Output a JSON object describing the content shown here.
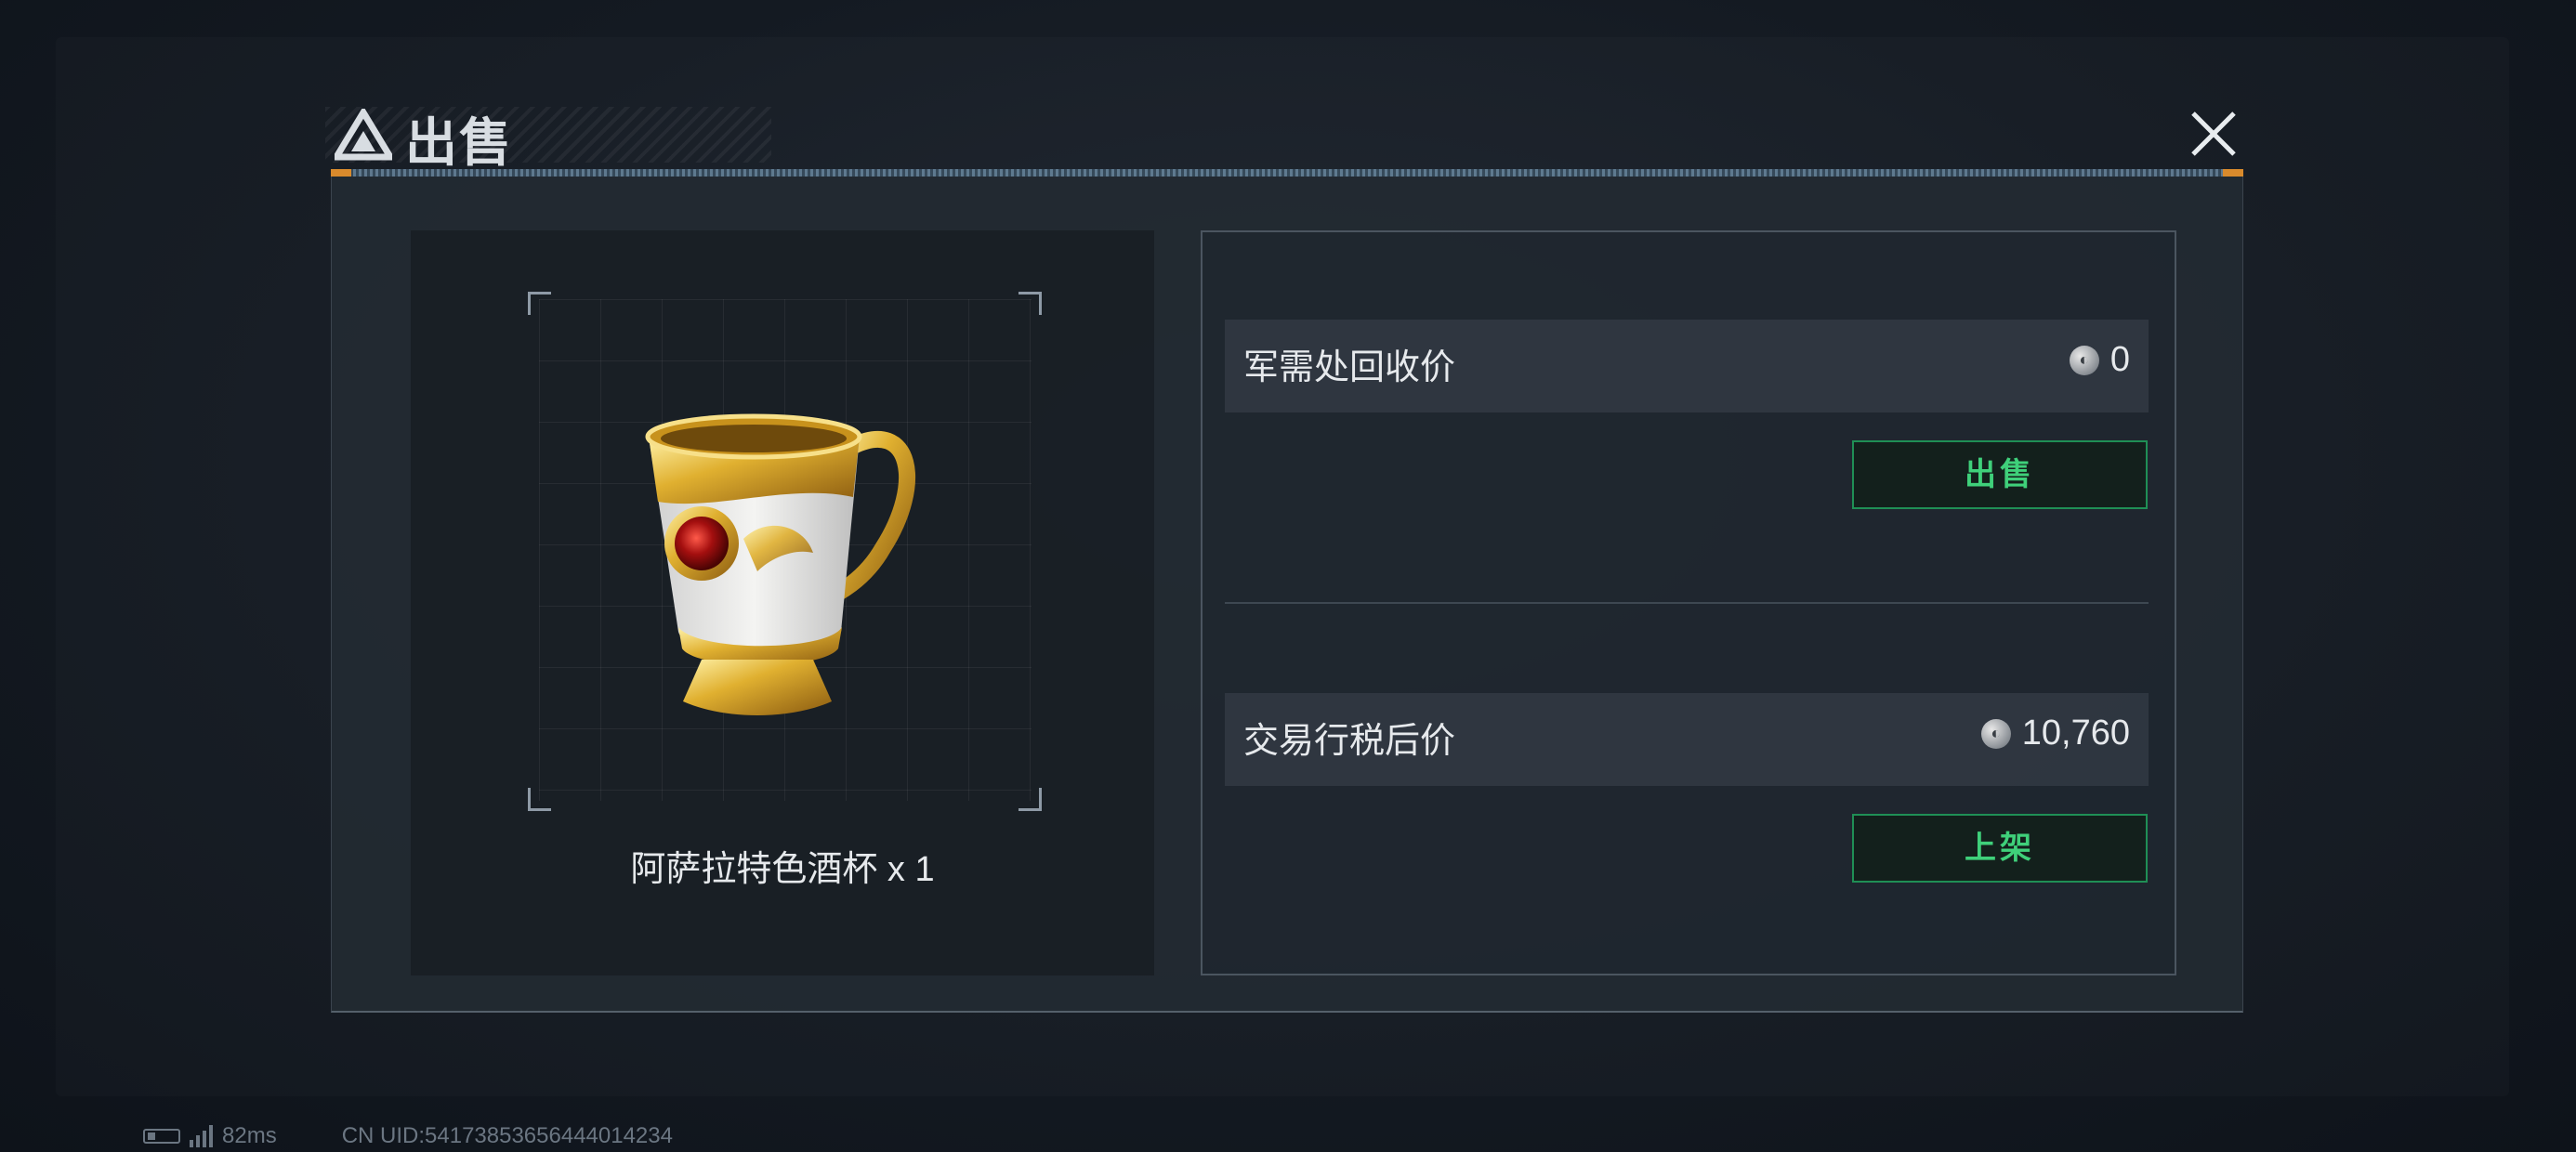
{
  "dialog": {
    "title": "出售",
    "close_icon": "close-icon"
  },
  "item": {
    "name": "阿萨拉特色酒杯 x 1",
    "image_icon": "golden-cup-icon"
  },
  "recycle": {
    "label": "军需处回收价",
    "value": "0",
    "currency_icon": "coin-icon",
    "button_label": "出售"
  },
  "market": {
    "label": "交易行税后价",
    "value": "10,760",
    "currency_icon": "coin-icon",
    "button_label": "上架"
  },
  "status": {
    "ping": "82ms",
    "uid": "CN UID:54173853656444014234"
  },
  "colors": {
    "accent_green": "#3fd07a",
    "button_border": "#1f8f55",
    "divider_orange": "#d98a2c"
  }
}
